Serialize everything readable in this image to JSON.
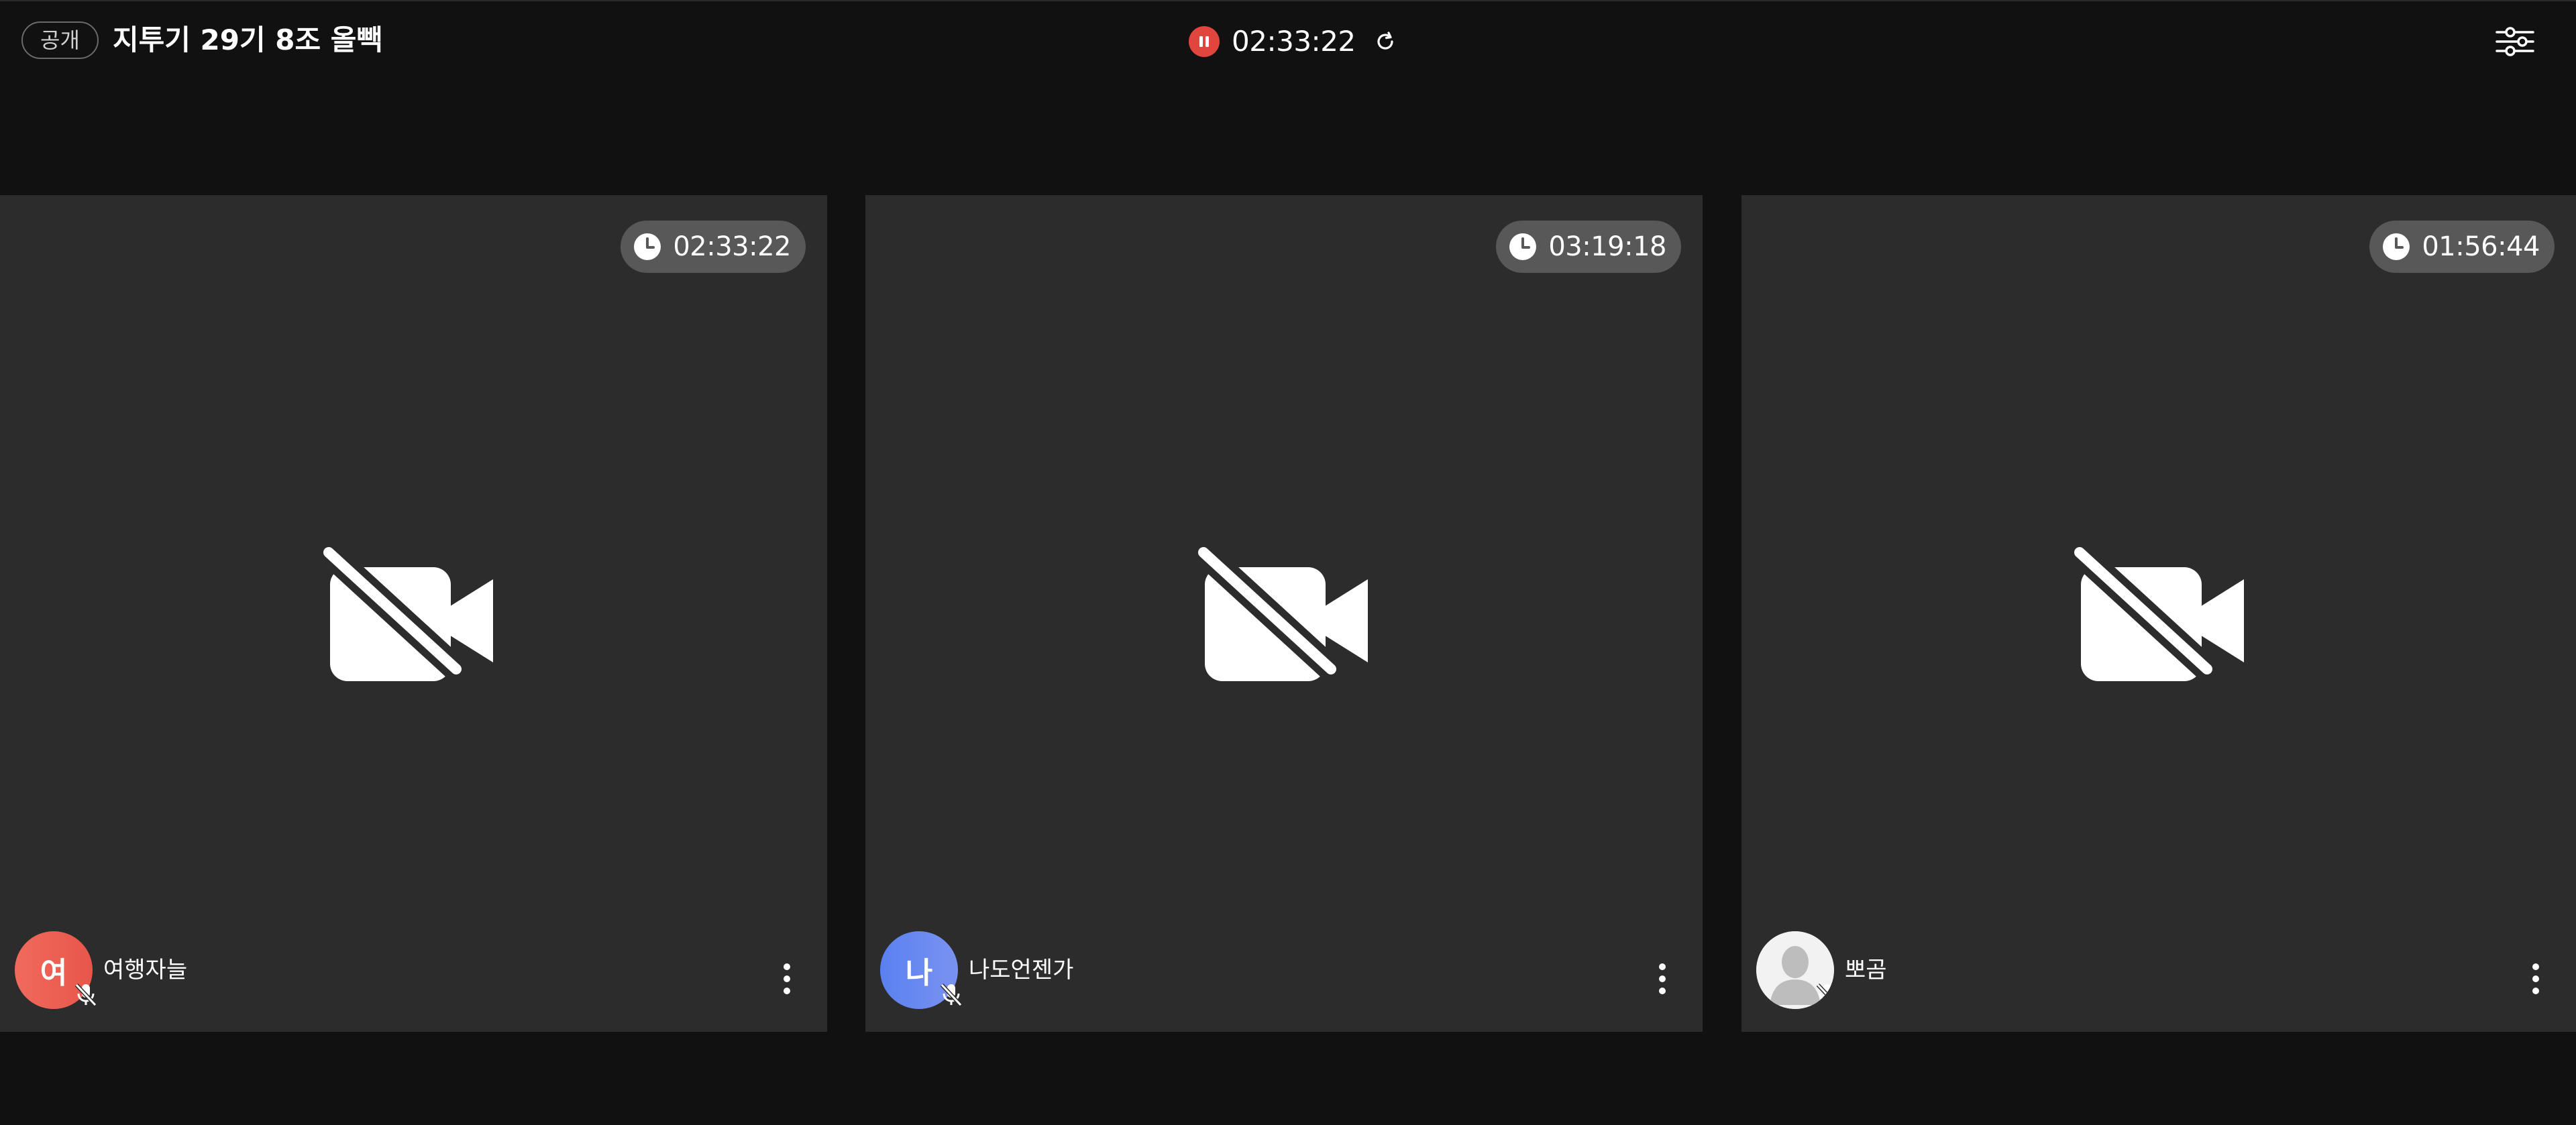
{
  "header": {
    "visibility_label": "공개",
    "room_title": "지투기 29기 8조 올빽",
    "timer": "02:33:22"
  },
  "colors": {
    "background": "#111111",
    "tile_background": "#2c2c2c",
    "accent_red": "#e0463e",
    "timer_pill": "#585858"
  },
  "icons": {
    "pause": "pause-icon",
    "refresh": "refresh-icon",
    "settings": "sliders-icon",
    "clock": "clock-icon",
    "camera_off": "video-off-icon",
    "mic_off": "mic-off-icon",
    "more": "more-vertical-icon"
  },
  "participants": [
    {
      "name": "여행자늘",
      "avatar_initial": "여",
      "avatar_color": "#ee5f53",
      "timer": "02:33:22"
    },
    {
      "name": "나도언젠가",
      "avatar_initial": "나",
      "avatar_color": "#6a89f0",
      "timer": "03:19:18"
    },
    {
      "name": "뽀곰",
      "avatar_initial": "",
      "avatar_color": "#f2f2f2",
      "timer": "01:56:44"
    }
  ]
}
